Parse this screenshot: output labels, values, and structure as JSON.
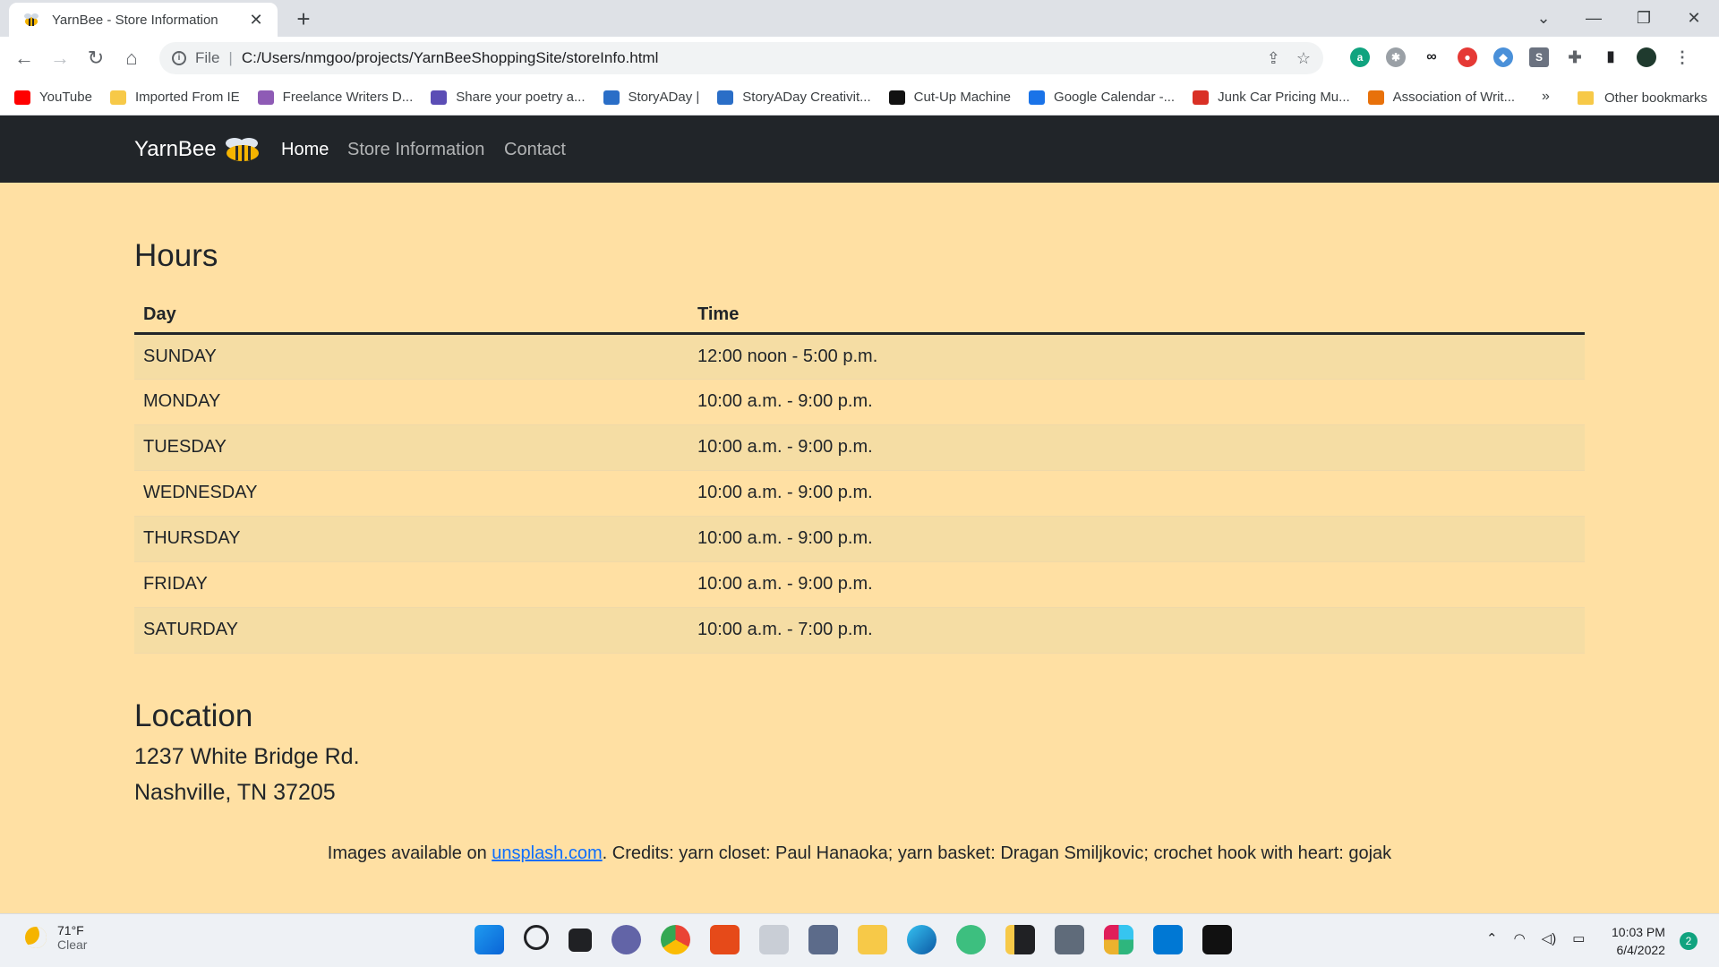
{
  "browser": {
    "tab_title": "YarnBee - Store Information",
    "url_scheme": "File",
    "url": "C:/Users/nmgoo/projects/YarnBeeShoppingSite/storeInfo.html",
    "bookmarks": [
      {
        "label": "YouTube",
        "icon": "youtube-icon",
        "color": "#ff0000"
      },
      {
        "label": "Imported From IE",
        "icon": "folder-icon",
        "color": "#f7c948"
      },
      {
        "label": "Freelance Writers D...",
        "icon": "d-icon",
        "color": "#8e5bb5"
      },
      {
        "label": "Share your poetry a...",
        "icon": "book-icon",
        "color": "#5b4db5"
      },
      {
        "label": "StoryADay |",
        "icon": "s-icon",
        "color": "#2a6ec7"
      },
      {
        "label": "StoryADay Creativit...",
        "icon": "s-icon",
        "color": "#2a6ec7"
      },
      {
        "label": "Cut-Up Machine",
        "icon": "cut-icon",
        "color": "#111111"
      },
      {
        "label": "Google Calendar -...",
        "icon": "calendar-icon",
        "color": "#1a73e8"
      },
      {
        "label": "Junk Car Pricing Mu...",
        "icon": "tn-icon",
        "color": "#d93025"
      },
      {
        "label": "Association of Writ...",
        "icon": "doc-icon",
        "color": "#e8710a"
      }
    ],
    "bookmarks_more": "»",
    "other_bookmarks": "Other bookmarks"
  },
  "site": {
    "brand": "YarnBee",
    "nav": [
      {
        "label": "Home",
        "active": true
      },
      {
        "label": "Store Information",
        "active": false
      },
      {
        "label": "Contact",
        "active": false
      }
    ],
    "hours_title": "Hours",
    "table_headers": {
      "day": "Day",
      "time": "Time"
    },
    "hours": [
      {
        "day": "SUNDAY",
        "time": "12:00 noon - 5:00 p.m."
      },
      {
        "day": "MONDAY",
        "time": "10:00 a.m. - 9:00 p.m."
      },
      {
        "day": "TUESDAY",
        "time": "10:00 a.m. - 9:00 p.m."
      },
      {
        "day": "WEDNESDAY",
        "time": "10:00 a.m. - 9:00 p.m."
      },
      {
        "day": "THURSDAY",
        "time": "10:00 a.m. - 9:00 p.m."
      },
      {
        "day": "FRIDAY",
        "time": "10:00 a.m. - 9:00 p.m."
      },
      {
        "day": "SATURDAY",
        "time": "10:00 a.m. - 7:00 p.m."
      }
    ],
    "location_title": "Location",
    "address_line1": "1237 White Bridge Rd.",
    "address_line2": "Nashville, TN 37205",
    "credits_prefix": "Images available on ",
    "credits_link": "unsplash.com",
    "credits_suffix": ". Credits: yarn closet: Paul Hanaoka; yarn basket: Dragan Smiljkovic; crochet hook with heart: gojak"
  },
  "taskbar": {
    "temperature": "71°F",
    "condition": "Clear",
    "time": "10:03 PM",
    "date": "6/4/2022",
    "notifications": "2"
  },
  "colors": {
    "page_bg": "#ffe0a3",
    "navbar_bg": "#212529",
    "striped_row": "#f5dda4",
    "link": "#0d6efd"
  }
}
